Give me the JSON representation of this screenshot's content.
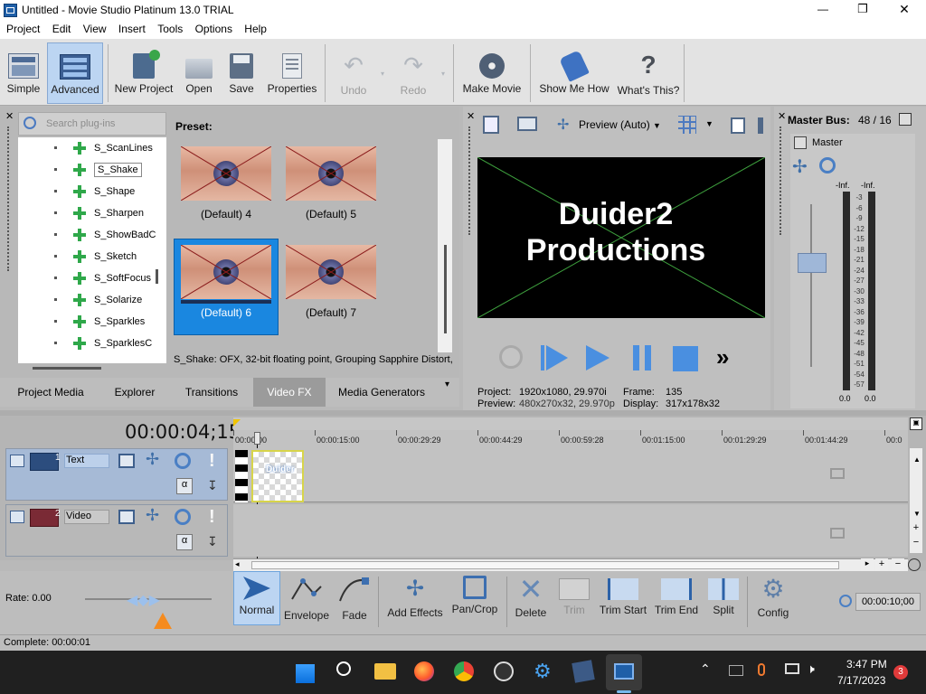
{
  "window": {
    "title": "Untitled - Movie Studio Platinum 13.0 TRIAL",
    "minimize": "—",
    "maximize": "❐",
    "close": "✕"
  },
  "menu": [
    "Project",
    "Edit",
    "View",
    "Insert",
    "Tools",
    "Options",
    "Help"
  ],
  "toolbar": {
    "simple": "Simple",
    "advanced": "Advanced",
    "new_project": "New Project",
    "open": "Open",
    "save": "Save",
    "properties": "Properties",
    "undo": "Undo",
    "redo": "Redo",
    "make_movie": "Make Movie",
    "show_me_how": "Show Me How",
    "whats_this": "What's This?"
  },
  "plugins": {
    "search_placeholder": "Search plug-ins",
    "items": [
      "S_ScanLines",
      "S_Shake",
      "S_Shape",
      "S_Sharpen",
      "S_ShowBadC",
      "S_Sketch",
      "S_SoftFocus",
      "S_Solarize",
      "S_Sparkles",
      "S_SparklesC"
    ],
    "selected_index": 1
  },
  "presets": {
    "label": "Preset:",
    "items": [
      "(Default) 4",
      "(Default) 5",
      "(Default) 6",
      "(Default) 7"
    ],
    "selected_index": 2,
    "status": "S_Shake: OFX, 32-bit floating point, Grouping  Sapphire Distort,"
  },
  "tabs": [
    "Project Media",
    "Explorer",
    "Transitions",
    "Video FX",
    "Media Generators"
  ],
  "active_tab": "Video FX",
  "preview": {
    "mode": "Preview (Auto)",
    "text_line1": "Duider2",
    "text_line2": "Productions",
    "project_label": "Project:",
    "project_value": "1920x1080, 29.970i",
    "preview_label": "Preview:",
    "preview_value": "480x270x32, 29.970p",
    "frame_label": "Frame:",
    "frame_value": "135",
    "display_label": "Display:",
    "display_value": "317x178x32"
  },
  "master": {
    "title": "Master Bus:",
    "value": "48 / 16",
    "label": "Master",
    "inf_left": "-Inf.",
    "inf_right": "-Inf.",
    "scale": [
      "3",
      "6",
      "9",
      "12",
      "15",
      "18",
      "21",
      "24",
      "27",
      "30",
      "33",
      "36",
      "39",
      "42",
      "45",
      "48",
      "51",
      "54",
      "57"
    ],
    "bottom_left": "0.0",
    "bottom_right": "0.0"
  },
  "timeline": {
    "timecode": "00:00:04;15",
    "ruler": [
      "00:00:00",
      "00:00:15:00",
      "00:00:29:29",
      "00:00:44:29",
      "00:00:59:28",
      "00:01:15:00",
      "00:01:29:29",
      "00:01:44:29",
      "00:0"
    ],
    "tracks": [
      {
        "num": "1",
        "name": "Text",
        "clip_text": "Duider\nduct"
      },
      {
        "num": "2",
        "name": "Video"
      }
    ]
  },
  "edit_toolbar": {
    "rate": "Rate: 0.00",
    "normal": "Normal",
    "envelope": "Envelope",
    "fade": "Fade",
    "add_effects": "Add Effects",
    "pan_crop": "Pan/Crop",
    "delete": "Delete",
    "trim": "Trim",
    "trim_start": "Trim Start",
    "trim_end": "Trim End",
    "split": "Split",
    "config": "Config",
    "time": "00:00:10;00"
  },
  "status": "Complete: 00:00:01",
  "taskbar": {
    "time": "3:47 PM",
    "date": "7/17/2023",
    "badge": "3"
  },
  "colors": {
    "accent": "#0078d7",
    "selection": "#bcd5f2",
    "track_blue": "#a6bad6"
  }
}
